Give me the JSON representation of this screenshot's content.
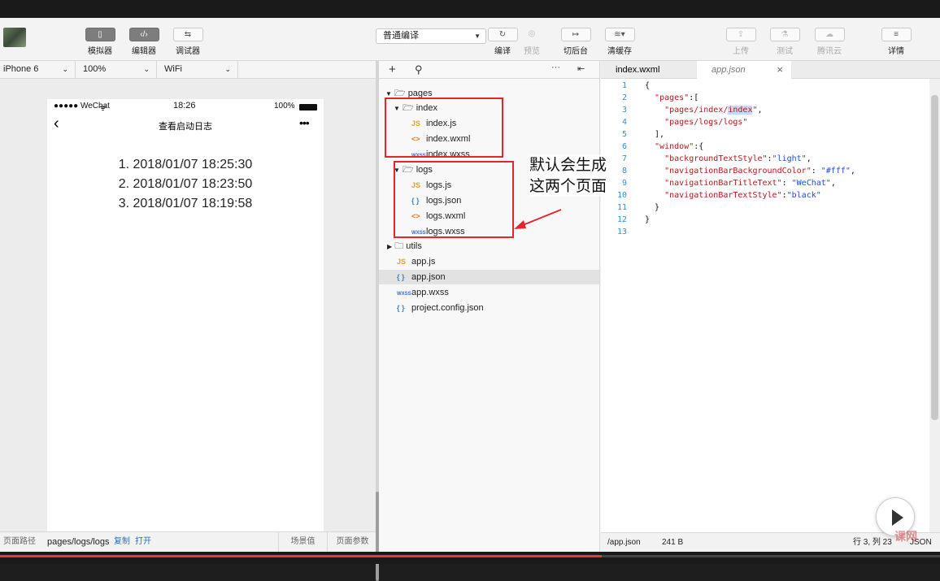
{
  "toolbar": {
    "simulator": "模拟器",
    "editor": "编辑器",
    "debugger": "调试器",
    "compile_mode": "普通编译",
    "compile": "编译",
    "preview": "预览",
    "background": "切后台",
    "clear_cache": "清缓存",
    "upload": "上传",
    "test": "测试",
    "tencent_cloud": "腾讯云",
    "details": "详情"
  },
  "device_bar": {
    "device": "iPhone 6",
    "zoom": "100%",
    "network": "WiFi"
  },
  "phone": {
    "carrier": "●●●●● WeChat",
    "time": "18:26",
    "battery": "100%",
    "title": "查看启动日志",
    "logs": [
      "1. 2018/01/07 18:25:30",
      "2. 2018/01/07 18:23:50",
      "3. 2018/01/07 18:19:58"
    ]
  },
  "sim_footer": {
    "path_label": "页面路径",
    "path": "pages/logs/logs",
    "copy": "复制",
    "open": "打开",
    "scene": "场景值",
    "params": "页面参数"
  },
  "file_tree": {
    "pages": "pages",
    "index": "index",
    "index_js": "index.js",
    "index_wxml": "index.wxml",
    "index_wxss": "index.wxss",
    "logs": "logs",
    "logs_js": "logs.js",
    "logs_json": "logs.json",
    "logs_wxml": "logs.wxml",
    "logs_wxss": "logs.wxss",
    "utils": "utils",
    "app_js": "app.js",
    "app_json": "app.json",
    "app_wxss": "app.wxss",
    "project_config": "project.config.json"
  },
  "editor": {
    "tabs": [
      "index.wxml",
      "app.json"
    ],
    "line_numbers": [
      "1",
      "2",
      "3",
      "4",
      "5",
      "6",
      "7",
      "8",
      "9",
      "10",
      "11",
      "12",
      "13"
    ],
    "footer_path": "/app.json",
    "footer_size": "241 B",
    "footer_pos": "行 3, 列 23",
    "footer_lang": "JSON"
  },
  "annotation": {
    "line1": "默认会生成",
    "line2": "这两个页面"
  },
  "video": {
    "progress": 0.64
  },
  "colors": {
    "annotation_red": "#e5252a",
    "line_number_blue": "#3a8fc9"
  }
}
